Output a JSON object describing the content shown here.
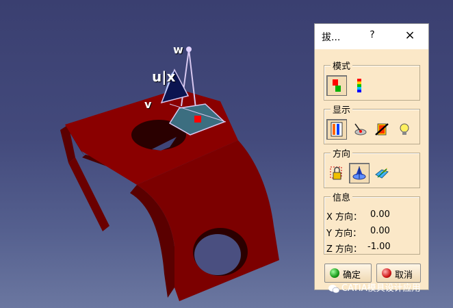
{
  "viewport": {
    "axis_w_label": "w",
    "axis_u_label": "u|x",
    "axis_v_label": "v",
    "part_color": "#7a0000",
    "background_color": "#3f4577"
  },
  "dialog": {
    "title": "拔...",
    "help_label": "?",
    "close_label": "×",
    "mode_group": {
      "label": "模式",
      "buttons": [
        {
          "icon": "draft-analysis-mode-icon",
          "pressed": true
        },
        {
          "icon": "color-gradient-mode-icon",
          "pressed": false
        }
      ]
    },
    "display_group": {
      "label": "显示",
      "buttons": [
        {
          "icon": "color-scale-icon",
          "pressed": true
        },
        {
          "icon": "cursor-on-surface-icon",
          "pressed": false
        },
        {
          "icon": "inspection-off-icon",
          "pressed": false
        },
        {
          "icon": "lightbulb-icon",
          "pressed": false
        }
      ]
    },
    "direction_group": {
      "label": "方向",
      "buttons": [
        {
          "icon": "lock-direction-icon",
          "pressed": false
        },
        {
          "icon": "compass-direction-icon",
          "pressed": true
        },
        {
          "icon": "plane-direction-icon",
          "pressed": false
        }
      ]
    },
    "info_group": {
      "label": "信息",
      "x_label": "X 方向：",
      "x_value": "0.00",
      "y_label": "Y 方向：",
      "y_value": "0.00",
      "z_label": "Z 方向：",
      "z_value": "-1.00"
    },
    "ok_label": "确定",
    "cancel_label": "取消",
    "ok_color": "#22a022",
    "cancel_color": "#d02020"
  },
  "watermark": "CATIA模具设计应用"
}
